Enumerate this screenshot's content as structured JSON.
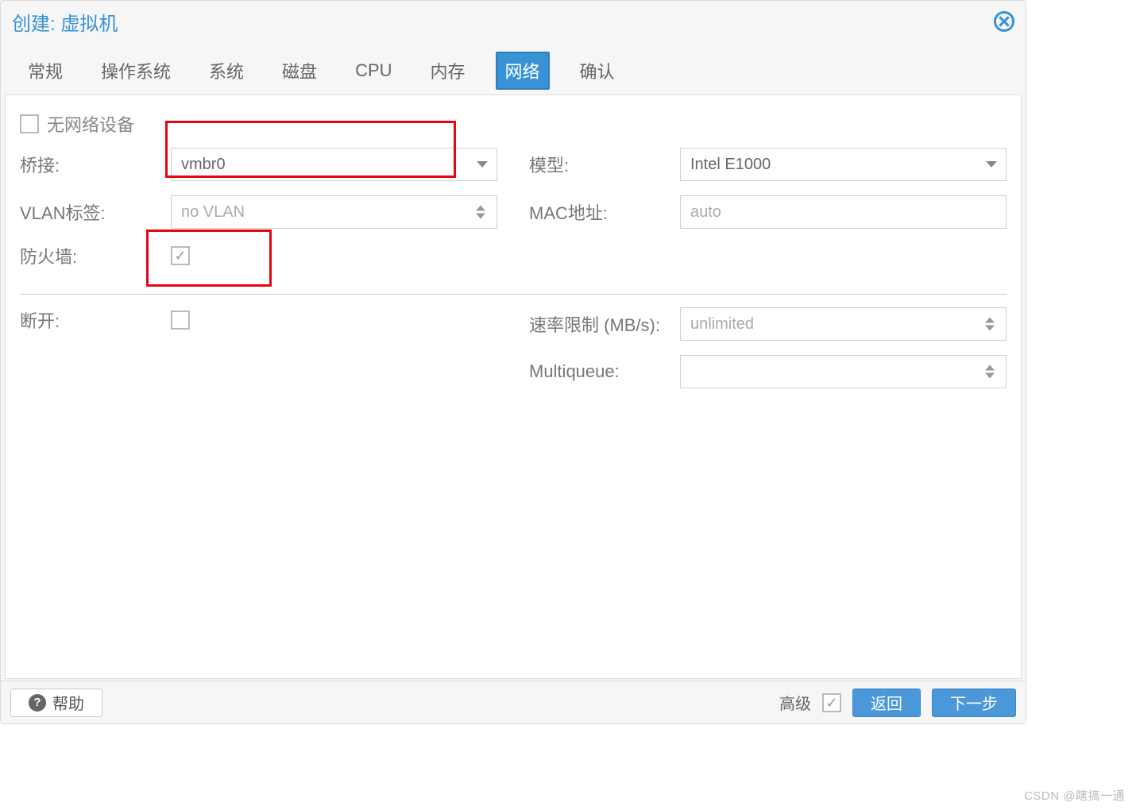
{
  "dialog": {
    "title": "创建: 虚拟机"
  },
  "tabs": [
    {
      "label": "常规"
    },
    {
      "label": "操作系统"
    },
    {
      "label": "系统"
    },
    {
      "label": "磁盘"
    },
    {
      "label": "CPU"
    },
    {
      "label": "内存"
    },
    {
      "label": "网络",
      "active": true
    },
    {
      "label": "确认"
    }
  ],
  "form": {
    "no_network_label": "无网络设备",
    "no_network_checked": false,
    "bridge_label": "桥接:",
    "bridge_value": "vmbr0",
    "vlan_label": "VLAN标签:",
    "vlan_placeholder": "no VLAN",
    "firewall_label": "防火墙:",
    "firewall_checked": true,
    "disconnect_label": "断开:",
    "disconnect_checked": false,
    "model_label": "模型:",
    "model_value": "Intel E1000",
    "mac_label": "MAC地址:",
    "mac_placeholder": "auto",
    "rate_label": "速率限制 (MB/s):",
    "rate_placeholder": "unlimited",
    "multiqueue_label": "Multiqueue:",
    "multiqueue_value": ""
  },
  "footer": {
    "help": "帮助",
    "advanced": "高级",
    "advanced_checked": true,
    "back": "返回",
    "next": "下一步"
  },
  "watermark": "CSDN @瞎搞一通"
}
